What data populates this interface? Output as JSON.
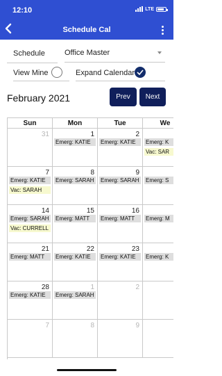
{
  "status_bar": {
    "time": "12:10",
    "network": "LTE",
    "battery_level": 0.85
  },
  "nav": {
    "title": "Schedule Cal",
    "back_icon": "chevron-left-icon",
    "menu_icon": "kebab-menu-icon"
  },
  "filters": {
    "schedule_label": "Schedule",
    "schedule_value": "Office Master",
    "view_mine_label": "View Mine",
    "view_mine_checked": false,
    "expand_calendar_label": "Expand Calendar",
    "expand_calendar_checked": true
  },
  "calendar": {
    "month_title": "February 2021",
    "prev_label": "Prev",
    "next_label": "Next",
    "day_names": [
      "Sun",
      "Mon",
      "Tue",
      "We"
    ],
    "weeks": [
      {
        "days": [
          {
            "num": "31",
            "out": true,
            "events": []
          },
          {
            "num": "1",
            "events": [
              {
                "type": "emerg",
                "text": "Emerg: KATIE"
              }
            ]
          },
          {
            "num": "2",
            "events": [
              {
                "type": "emerg",
                "text": "Emerg: KATIE"
              }
            ]
          },
          {
            "num": "",
            "events": [
              {
                "type": "emerg",
                "text": "Emerg: K"
              },
              {
                "type": "vac",
                "text": "Vac: SAR"
              }
            ]
          }
        ]
      },
      {
        "days": [
          {
            "num": "7",
            "events": [
              {
                "type": "emerg",
                "text": "Emerg: KATIE"
              },
              {
                "type": "vac",
                "text": "Vac: SARAH"
              }
            ]
          },
          {
            "num": "8",
            "events": [
              {
                "type": "emerg",
                "text": "Emerg: SARAH"
              }
            ]
          },
          {
            "num": "9",
            "events": [
              {
                "type": "emerg",
                "text": "Emerg: SARAH"
              }
            ]
          },
          {
            "num": "",
            "events": [
              {
                "type": "emerg",
                "text": "Emerg: S"
              }
            ]
          }
        ]
      },
      {
        "days": [
          {
            "num": "14",
            "events": [
              {
                "type": "emerg",
                "text": "Emerg: SARAH"
              },
              {
                "type": "vac",
                "text": "Vac: CURRELL"
              }
            ]
          },
          {
            "num": "15",
            "events": [
              {
                "type": "emerg",
                "text": "Emerg: MATT"
              }
            ]
          },
          {
            "num": "16",
            "events": [
              {
                "type": "emerg",
                "text": "Emerg: MATT"
              }
            ]
          },
          {
            "num": "",
            "events": [
              {
                "type": "emerg",
                "text": "Emerg: M"
              }
            ]
          }
        ]
      },
      {
        "days": [
          {
            "num": "21",
            "events": [
              {
                "type": "emerg",
                "text": "Emerg: MATT"
              }
            ]
          },
          {
            "num": "22",
            "events": [
              {
                "type": "emerg",
                "text": "Emerg: KATIE"
              }
            ]
          },
          {
            "num": "23",
            "events": [
              {
                "type": "emerg",
                "text": "Emerg: KATIE"
              }
            ]
          },
          {
            "num": "",
            "events": [
              {
                "type": "emerg",
                "text": "Emerg: K"
              }
            ]
          }
        ]
      },
      {
        "days": [
          {
            "num": "28",
            "events": [
              {
                "type": "emerg",
                "text": "Emerg: KATIE"
              }
            ]
          },
          {
            "num": "1",
            "out": true,
            "events": [
              {
                "type": "emerg",
                "text": "Emerg: SARAH"
              }
            ]
          },
          {
            "num": "2",
            "out": true,
            "events": []
          },
          {
            "num": "",
            "events": []
          }
        ]
      },
      {
        "days": [
          {
            "num": "7",
            "out": true,
            "events": []
          },
          {
            "num": "8",
            "out": true,
            "events": []
          },
          {
            "num": "9",
            "out": true,
            "events": []
          },
          {
            "num": "",
            "events": []
          }
        ]
      }
    ]
  },
  "colors": {
    "nav_blue": "#2f4fd2",
    "button_navy": "#101f5b",
    "emerg_bg": "#dedede",
    "vac_bg": "#f7f9cf"
  }
}
